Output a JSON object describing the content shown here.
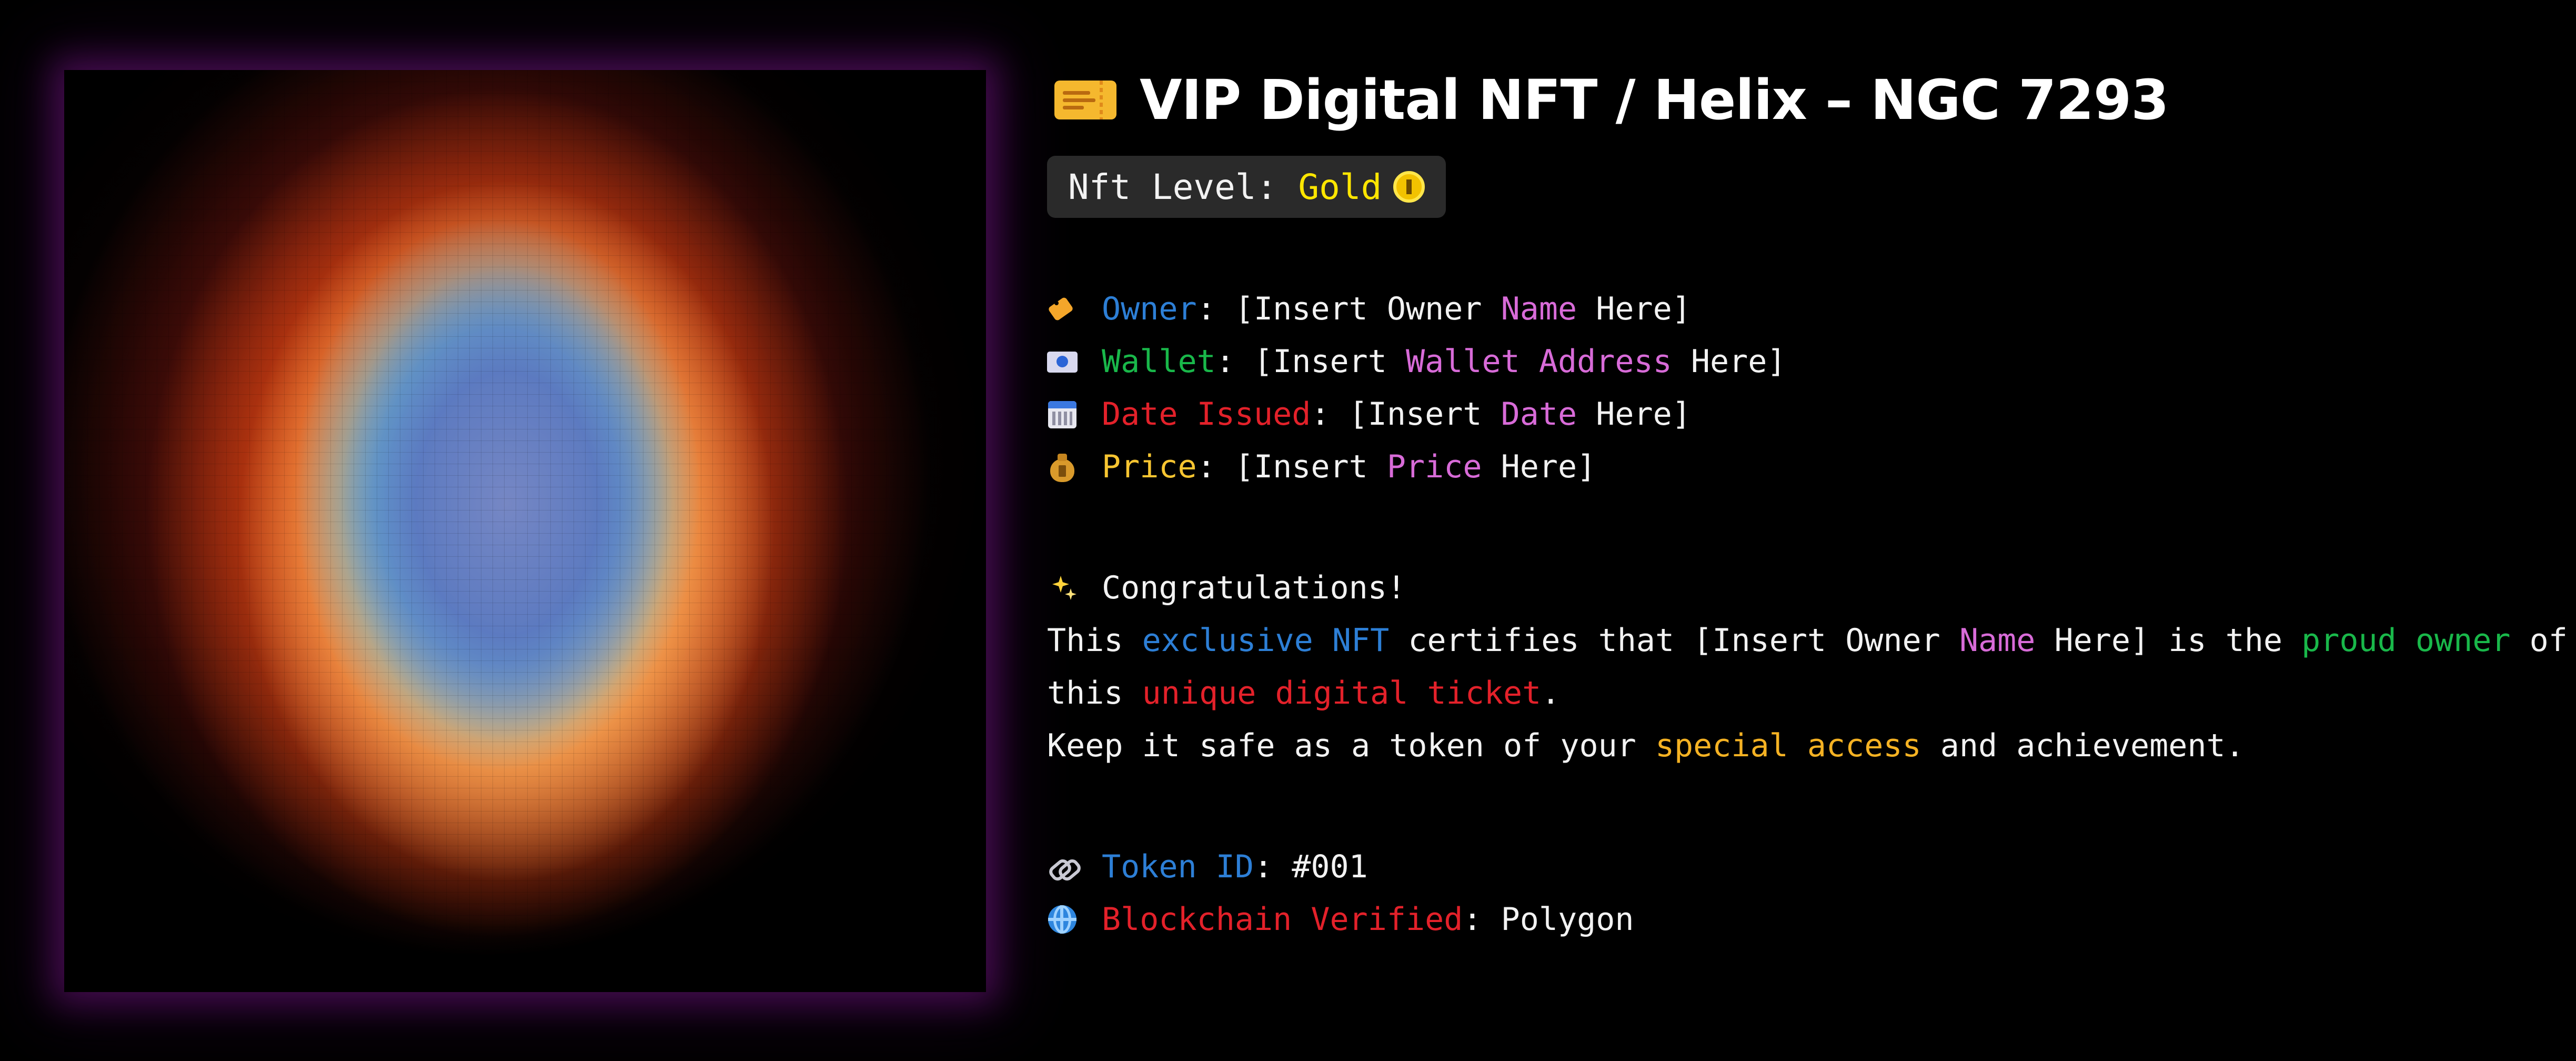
{
  "image": {
    "alt_label": "Helix Nebula pixel art"
  },
  "header": {
    "title": "VIP Digital NFT / Helix – NGC 7293",
    "ticket_icon": "admission-ticket-icon"
  },
  "level": {
    "label": "Nft Level:",
    "value": "Gold",
    "icon": "coin-icon",
    "value_color": "#ffe600"
  },
  "details": [
    {
      "icon": "label-tag-icon",
      "key": "Owner",
      "key_color": "#2d7fd6",
      "sep": ": ",
      "pre": "[Insert Owner ",
      "hl": "Name",
      "post": " Here]"
    },
    {
      "icon": "wallet-card-icon",
      "key": "Wallet",
      "key_color": "#19b84a",
      "sep": ": ",
      "pre": "[Insert ",
      "hl": "Wallet Address",
      "post": " Here]"
    },
    {
      "icon": "calendar-icon",
      "key": "Date Issued",
      "key_color": "#e3212a",
      "sep": ": ",
      "pre": "[Insert ",
      "hl": "Date",
      "post": " Here]"
    },
    {
      "icon": "money-bag-icon",
      "key": "Price",
      "key_color": "#f7c531",
      "sep": ": ",
      "pre": "[Insert ",
      "hl": "Price",
      "post": " Here]"
    }
  ],
  "message": {
    "heading_icon": "sparkles-icon",
    "heading": "Congratulations!",
    "line1": {
      "a": "This ",
      "b": "exclusive NFT",
      "c": " certifies that [Insert Owner ",
      "d": "Name",
      "e": " Here] is the ",
      "f": "proud owner",
      "g": " of"
    },
    "line2": {
      "a": "this ",
      "b": "unique digital ticket",
      "c": "."
    },
    "line3": {
      "a": "Keep it safe as a token of your ",
      "b": "special access",
      "c": " and achievement."
    }
  },
  "token": {
    "icon": "link-icon",
    "key": "Token ID",
    "sep": ": ",
    "value": "#001"
  },
  "chain": {
    "icon": "globe-icon",
    "key": "Blockchain Verified",
    "sep": ": ",
    "value": "Polygon"
  },
  "colors": {
    "background": "#000000",
    "glow": "#961eaa",
    "blue": "#2d7fd6",
    "green": "#19b84a",
    "red": "#e3212a",
    "yellow": "#f7c531",
    "pink": "#d86bd8"
  }
}
